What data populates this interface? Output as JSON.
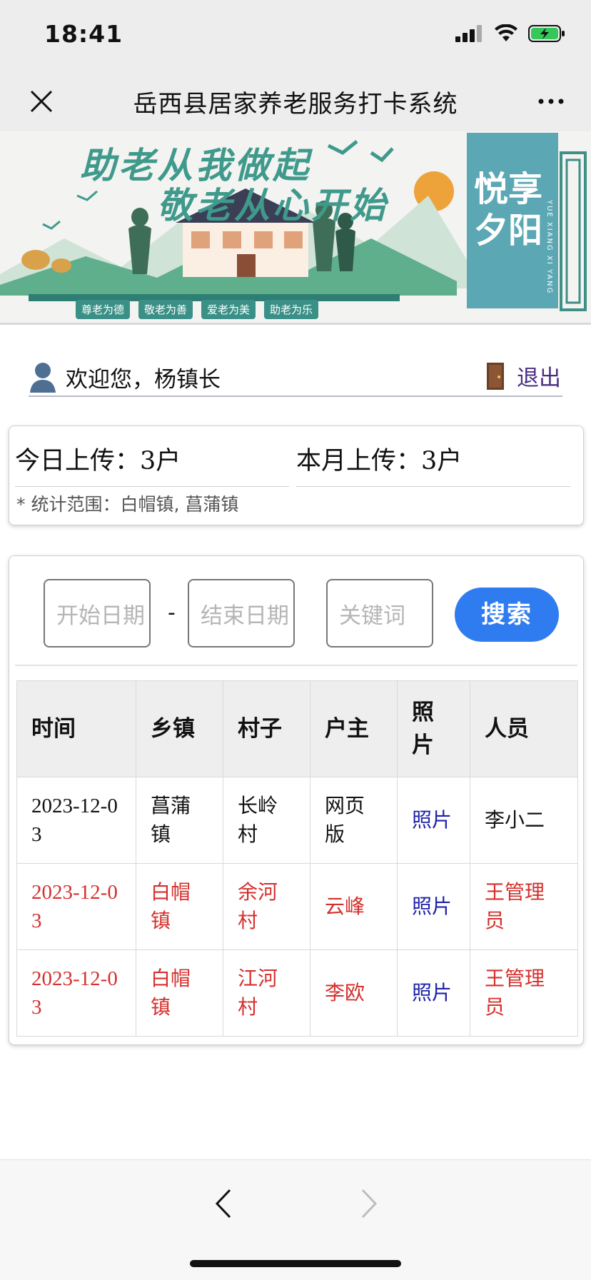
{
  "status_bar": {
    "time": "18:41"
  },
  "nav": {
    "title": "岳西县居家养老服务打卡系统"
  },
  "banner": {
    "slogan_line1": "助老从我做起",
    "slogan_line2": "敬老从心开始",
    "tags": [
      "尊老为德",
      "敬老为善",
      "爱老为美",
      "助老为乐"
    ],
    "panel_text": "悦享夕阳",
    "panel_subtext": "YUE XIANG XI YANG"
  },
  "welcome": {
    "greeting": "欢迎您，杨镇长",
    "logout": "退出"
  },
  "stats": {
    "today_label": "今日上传：",
    "today_value": "3户",
    "month_label": "本月上传：",
    "month_value": "3户",
    "scope": "* 统计范围：白帽镇, 菖蒲镇"
  },
  "search": {
    "start_placeholder": "开始日期",
    "separator": "-",
    "end_placeholder": "结束日期",
    "keyword_placeholder": "关键词",
    "button": "搜索"
  },
  "table": {
    "headers": [
      "时间",
      "乡镇",
      "村子",
      "户主",
      "照片",
      "人员"
    ],
    "rows": [
      {
        "time": "2023-12-03",
        "town": "菖蒲镇",
        "village": "长岭村",
        "owner": "网页版",
        "photo": "照片",
        "staff": "李小二",
        "highlight": false
      },
      {
        "time": "2023-12-03",
        "town": "白帽镇",
        "village": "余河村",
        "owner": "云峰",
        "photo": "照片",
        "staff": "王管理员",
        "highlight": true
      },
      {
        "time": "2023-12-03",
        "town": "白帽镇",
        "village": "江河村",
        "owner": "李欧",
        "photo": "照片",
        "staff": "王管理员",
        "highlight": true
      }
    ]
  },
  "colors": {
    "accent_blue": "#2f7cf0",
    "highlight_red": "#d4302d",
    "link_blue": "#1f22a8",
    "logout_purple": "#4b2e83"
  }
}
